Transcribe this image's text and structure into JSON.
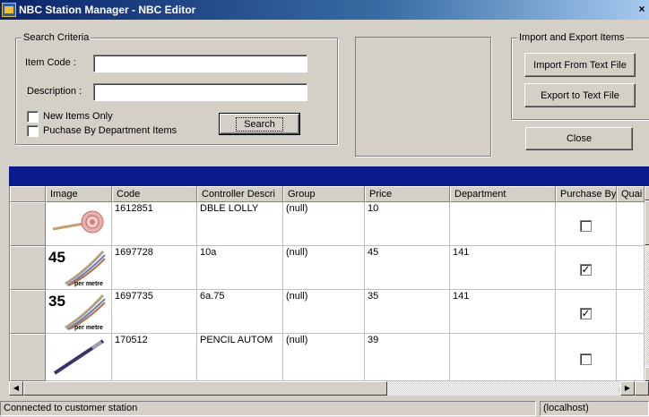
{
  "window": {
    "title": "NBC Station Manager - NBC Editor",
    "close_glyph": "×",
    "icon": "app-icon"
  },
  "search_criteria": {
    "legend": "Search Criteria",
    "item_code_label": "Item Code :",
    "item_code_value": "",
    "description_label": "Description :",
    "description_value": "",
    "new_items_only_label": "New Items Only",
    "new_items_only_checked": false,
    "purchase_by_department_label": "Puchase By Department Items",
    "purchase_by_department_checked": false,
    "search_button": "Search"
  },
  "import_export": {
    "legend": "Import and Export Items",
    "import_button": "Import From Text File",
    "export_button": "Export to Text File"
  },
  "close_button": "Close",
  "grid": {
    "columns": [
      "Image",
      "Code",
      "Controller Descri",
      "Group",
      "Price",
      "Department",
      "Purchase By De",
      "Quai"
    ],
    "rows": [
      {
        "image": "lolly-thumbnail",
        "image_text": "",
        "image_subtext": "",
        "code": "1612851",
        "description": "DBLE LOLLY",
        "group": "(null)",
        "price": "10",
        "department": "",
        "purchase_by_department": false
      },
      {
        "image": "cable-thumbnail",
        "image_text": "45",
        "image_subtext": "per metre",
        "code": "1697728",
        "description": "10a",
        "group": "(null)",
        "price": "45",
        "department": "141",
        "purchase_by_department": true
      },
      {
        "image": "cable-thumbnail",
        "image_text": "35",
        "image_subtext": "per metre",
        "code": "1697735",
        "description": "6a.75",
        "group": "(null)",
        "price": "35",
        "department": "141",
        "purchase_by_department": true
      },
      {
        "image": "pencil-thumbnail",
        "image_text": "",
        "image_subtext": "",
        "code": "170512",
        "description": "PENCIL AUTOM",
        "group": "(null)",
        "price": "39",
        "department": "",
        "purchase_by_department": false
      }
    ],
    "check_glyph": "✓"
  },
  "status_bar": {
    "message": "Connected to customer station",
    "server": "(localhost)"
  },
  "colors": {
    "title_bar": "#0a246a",
    "band": "#0a1c8c",
    "face": "#d4d0c8"
  }
}
